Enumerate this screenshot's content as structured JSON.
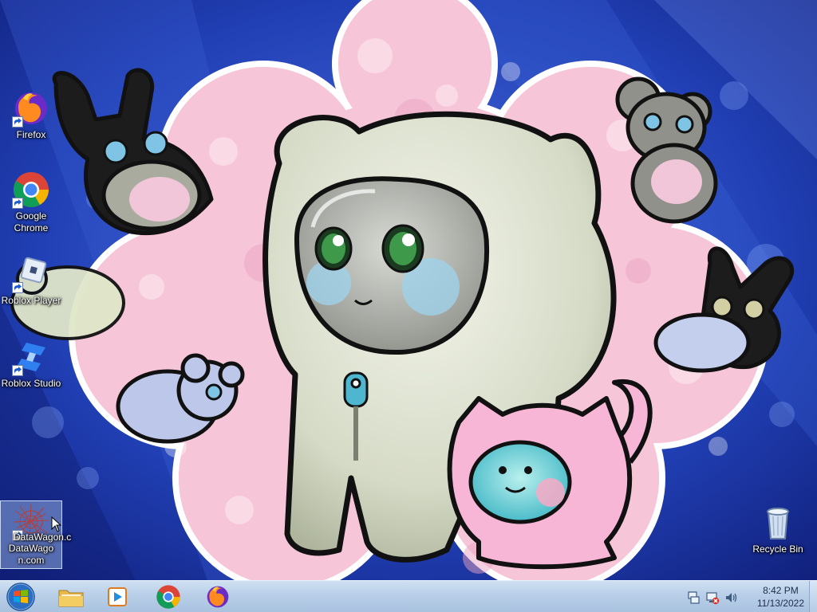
{
  "desktop": {
    "icons": [
      {
        "label": "Firefox",
        "icon": "firefox-icon"
      },
      {
        "label": "Google Chrome",
        "icon": "chrome-icon"
      },
      {
        "label": "Roblox Player",
        "icon": "roblox-player-icon"
      },
      {
        "label": "Roblox Studio",
        "icon": "roblox-studio-icon"
      },
      {
        "label": "DataWagon.com",
        "label_overlap": "DataWagon.c",
        "icon": "datawagon-icon",
        "selected": true
      },
      {
        "label": "Recycle Bin",
        "icon": "recycle-bin-icon"
      }
    ]
  },
  "taskbar": {
    "start_icon": "windows-start-icon",
    "pinned": [
      {
        "name": "Windows Explorer",
        "icon": "folder-icon"
      },
      {
        "name": "Windows Media Player",
        "icon": "media-player-icon"
      },
      {
        "name": "Google Chrome",
        "icon": "chrome-icon"
      },
      {
        "name": "Firefox",
        "icon": "firefox-icon"
      }
    ],
    "tray": {
      "icons": [
        "action-center-icon",
        "network-icon",
        "volume-icon"
      ],
      "time": "8:42 PM",
      "date": "11/13/2022"
    }
  },
  "colors": {
    "wallpaper_blue": "#1f3aa8",
    "wallpaper_pink": "#f6c6d8",
    "taskbar": "#bcd2ea"
  }
}
